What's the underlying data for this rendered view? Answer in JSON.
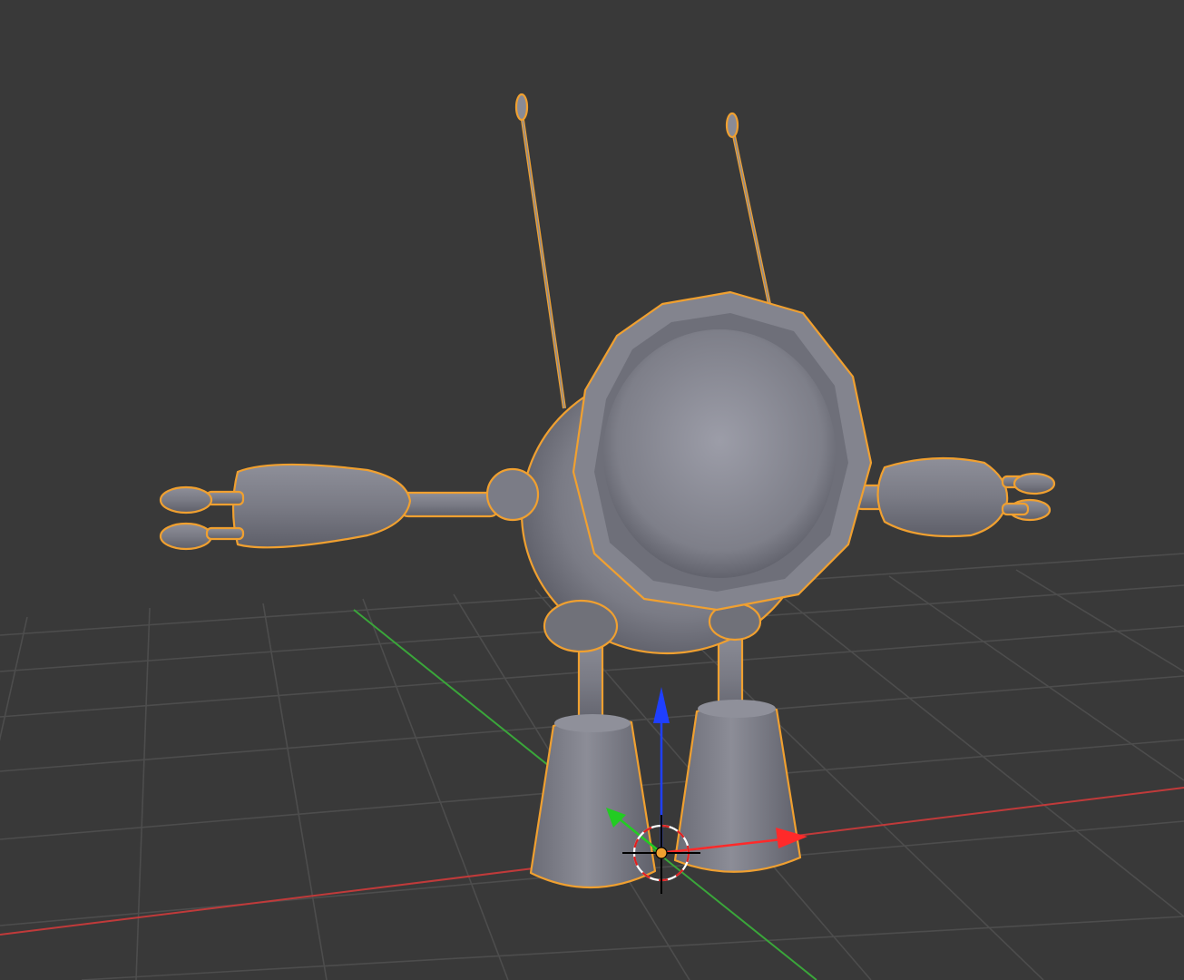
{
  "viewport": {
    "background": "#393939",
    "grid_color": "#4d4d4d",
    "x_axis_color": "#c03a3a",
    "y_axis_color": "#3aa63a",
    "selection_outline_color": "#f0a030",
    "mesh_color": "#7a7b85"
  },
  "scene": {
    "selected_object": "robot-mesh",
    "shading": "solid",
    "icons": [
      "3d-cursor-icon",
      "transform-gizmo-icon",
      "object-origin-icon"
    ]
  },
  "gizmo": {
    "z_arrow_color": "#1f3fff",
    "x_arrow_color": "#ff2a2a",
    "y_arrow_color": "#22cc22"
  }
}
